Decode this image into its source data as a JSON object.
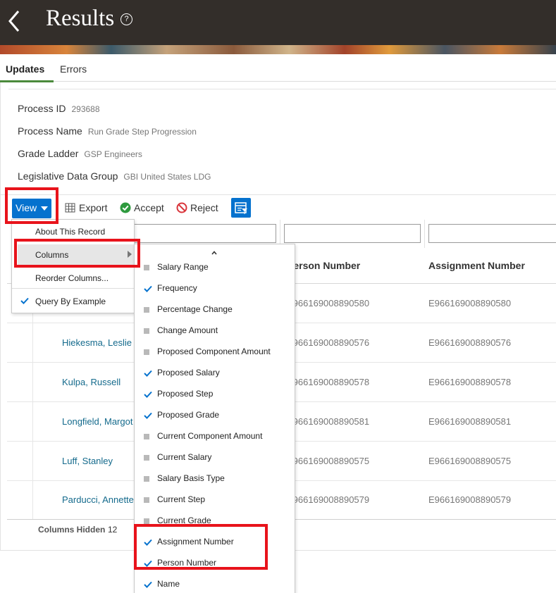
{
  "header": {
    "title": "Results",
    "help_symbol": "?"
  },
  "tabs": [
    {
      "label": "Updates",
      "active": true
    },
    {
      "label": "Errors",
      "active": false
    }
  ],
  "process": {
    "process_id_label": "Process ID",
    "process_id": "293688",
    "process_name_label": "Process Name",
    "process_name": "Run Grade Step Progression",
    "grade_ladder_label": "Grade Ladder",
    "grade_ladder": "GSP Engineers",
    "ldg_label": "Legislative Data Group",
    "ldg": "GBI United States LDG"
  },
  "toolbar": {
    "view": "View",
    "export": "Export",
    "accept": "Accept",
    "reject": "Reject"
  },
  "view_menu": {
    "about": "About This Record",
    "columns": "Columns",
    "reorder": "Reorder Columns...",
    "qbe": "Query By Example",
    "qbe_checked": true
  },
  "columns_menu": [
    {
      "label": "Salary Range",
      "checked": false
    },
    {
      "label": "Frequency",
      "checked": true
    },
    {
      "label": "Percentage Change",
      "checked": false
    },
    {
      "label": "Change Amount",
      "checked": false
    },
    {
      "label": "Proposed Component Amount",
      "checked": false
    },
    {
      "label": "Proposed Salary",
      "checked": true
    },
    {
      "label": "Proposed Step",
      "checked": true
    },
    {
      "label": "Proposed Grade",
      "checked": true
    },
    {
      "label": "Current Component Amount",
      "checked": false
    },
    {
      "label": "Current Salary",
      "checked": false
    },
    {
      "label": "Salary Basis Type",
      "checked": false
    },
    {
      "label": "Current Step",
      "checked": false
    },
    {
      "label": "Current Grade",
      "checked": false
    },
    {
      "label": "Assignment Number",
      "checked": true
    },
    {
      "label": "Person Number",
      "checked": true
    },
    {
      "label": "Name",
      "checked": true
    }
  ],
  "table": {
    "headers": {
      "person_number": "Person Number",
      "assignment_number": "Assignment Number"
    },
    "rows": [
      {
        "name": "",
        "person_number": "E966169008890580",
        "assignment_number": "E966169008890580"
      },
      {
        "name": "Hiekesma, Leslie",
        "person_number": "E966169008890576",
        "assignment_number": "E966169008890576"
      },
      {
        "name": "Kulpa, Russell",
        "person_number": "E966169008890578",
        "assignment_number": "E966169008890578"
      },
      {
        "name": "Longfield, Margot",
        "person_number": "E966169008890581",
        "assignment_number": "E966169008890581"
      },
      {
        "name": "Luff, Stanley",
        "person_number": "E966169008890575",
        "assignment_number": "E966169008890575"
      },
      {
        "name": "Parducci, Annette",
        "person_number": "E966169008890579",
        "assignment_number": "E966169008890579"
      }
    ],
    "columns_hidden_label": "Columns Hidden",
    "columns_hidden": "12"
  },
  "colors": {
    "header_bg": "#332e2a",
    "primary_blue": "#0572ce",
    "link": "#146a8c",
    "highlight_red": "#e8131b",
    "accept_green": "#2e9a3e",
    "reject_red": "#d9353b"
  }
}
